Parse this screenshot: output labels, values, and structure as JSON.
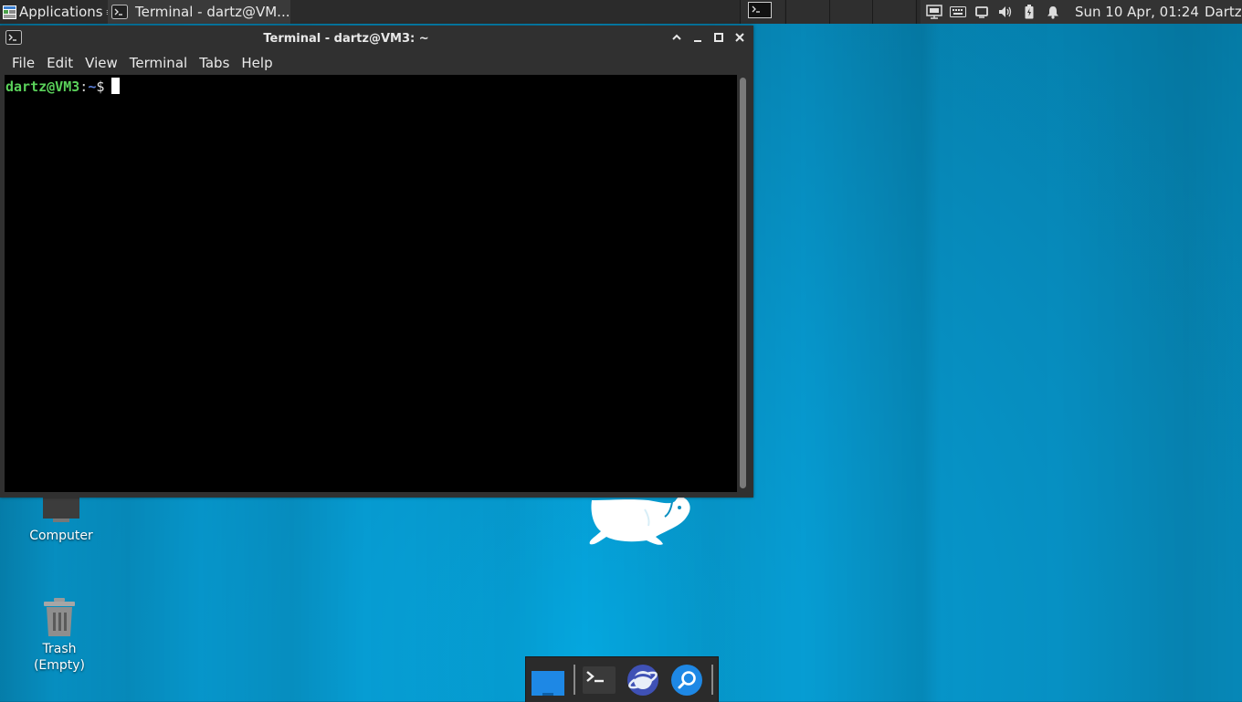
{
  "panel": {
    "apps_label": "Applications",
    "task_label": "Terminal - dartz@VM...",
    "clock": "Sun 10 Apr, 01:24",
    "user": "Dartz"
  },
  "window": {
    "title": "Terminal - dartz@VM3: ~",
    "menu": [
      "File",
      "Edit",
      "View",
      "Terminal",
      "Tabs",
      "Help"
    ]
  },
  "terminal": {
    "user_host": "dartz@VM3",
    "separator": ":",
    "path": "~",
    "symbol": "$"
  },
  "desktop": {
    "computer_label": "Computer",
    "trash_label": "Trash",
    "trash_status": "(Empty)"
  },
  "colors": {
    "panel_bg": "#2b2b2b",
    "desktop_bg": "#0696cb",
    "prompt_user": "#5ad15a",
    "prompt_path": "#5b7fd9"
  },
  "icons": [
    "applications-menu-icon",
    "terminal-icon",
    "network-icon",
    "keyboard-icon",
    "display-icon",
    "volume-icon",
    "battery-icon",
    "notification-bell-icon",
    "computer-icon",
    "trash-icon",
    "file-manager-icon",
    "web-browser-icon",
    "search-icon"
  ]
}
